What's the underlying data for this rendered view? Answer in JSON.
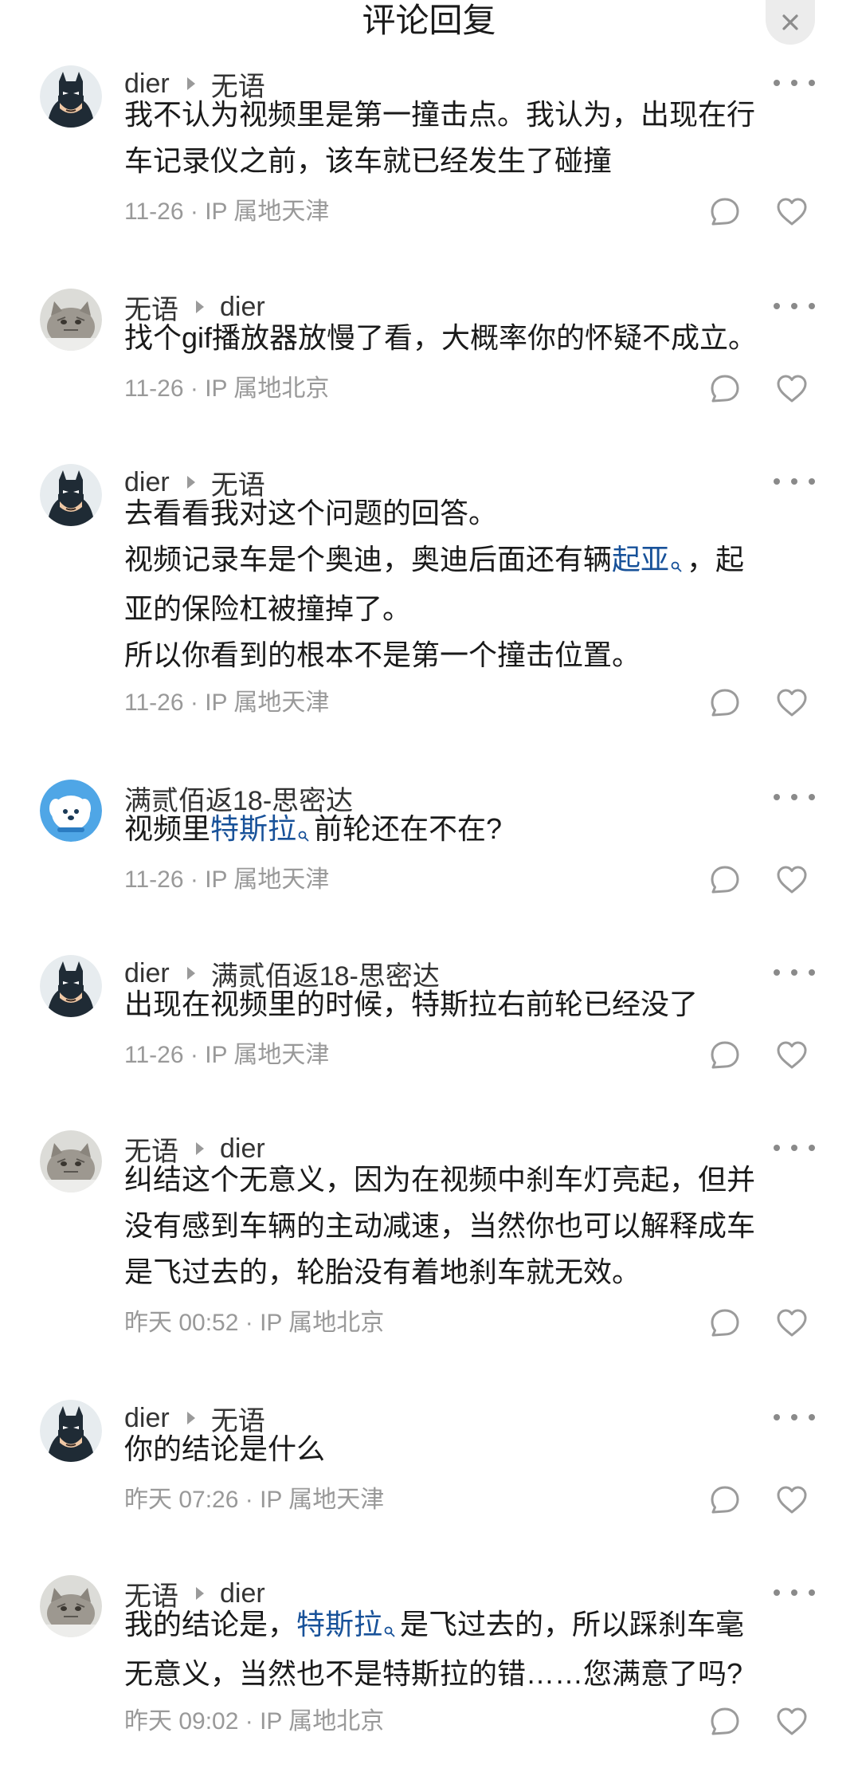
{
  "header": {
    "title": "评论回复"
  },
  "colors": {
    "link": "#175199",
    "meta": "#999999",
    "text": "#1a1a1a"
  },
  "comments": [
    {
      "avatar": "batman",
      "author": "dier",
      "reply_to": "无语",
      "lines": [
        [
          {
            "t": "我不认为视频里是第一撞击点。我认为，出现在行"
          }
        ],
        [
          {
            "t": "车记录仪之前，该车就已经发生了碰撞"
          }
        ]
      ],
      "date": "11-26",
      "ip": "IP 属地天津"
    },
    {
      "avatar": "cat",
      "author": "无语",
      "reply_to": "dier",
      "lines": [
        [
          {
            "t": "找个gif播放器放慢了看，大概率你的怀疑不成立。"
          }
        ]
      ],
      "date": "11-26",
      "ip": "IP 属地北京"
    },
    {
      "avatar": "batman",
      "author": "dier",
      "reply_to": "无语",
      "lines": [
        [
          {
            "t": "去看看我对这个问题的回答。"
          }
        ],
        [
          {
            "t": "视频记录车是个奥迪，奥迪后面还有辆"
          },
          {
            "t": "起亚",
            "link": true
          },
          {
            "t": "，起"
          }
        ],
        [
          {
            "t": "亚的保险杠被撞掉了。"
          }
        ],
        [
          {
            "t": "所以你看到的根本不是第一个撞击位置。"
          }
        ]
      ],
      "date": "11-26",
      "ip": "IP 属地天津"
    },
    {
      "avatar": "dog",
      "author": "满贰佰返18-思密达",
      "reply_to": "",
      "lines": [
        [
          {
            "t": "视频里"
          },
          {
            "t": "特斯拉",
            "link": true
          },
          {
            "t": "前轮还在不在?"
          }
        ]
      ],
      "date": "11-26",
      "ip": "IP 属地天津"
    },
    {
      "avatar": "batman",
      "author": "dier",
      "reply_to": "满贰佰返18-思密达",
      "lines": [
        [
          {
            "t": "出现在视频里的时候，特斯拉右前轮已经没了"
          }
        ]
      ],
      "date": "11-26",
      "ip": "IP 属地天津"
    },
    {
      "avatar": "cat",
      "author": "无语",
      "reply_to": "dier",
      "lines": [
        [
          {
            "t": "纠结这个无意义，因为在视频中刹车灯亮起，但并"
          }
        ],
        [
          {
            "t": "没有感到车辆的主动减速，当然你也可以解释成车"
          }
        ],
        [
          {
            "t": "是飞过去的，轮胎没有着地刹车就无效。"
          }
        ]
      ],
      "date": "昨天 00:52",
      "ip": "IP 属地北京"
    },
    {
      "avatar": "batman",
      "author": "dier",
      "reply_to": "无语",
      "lines": [
        [
          {
            "t": "你的结论是什么"
          }
        ]
      ],
      "date": "昨天 07:26",
      "ip": "IP 属地天津"
    },
    {
      "avatar": "cat",
      "author": "无语",
      "reply_to": "dier",
      "lines": [
        [
          {
            "t": "我的结论是，"
          },
          {
            "t": "特斯拉",
            "link": true
          },
          {
            "t": "是飞过去的，所以踩刹车毫"
          }
        ],
        [
          {
            "t": "无意义，当然也不是特斯拉的错……您满意了吗?"
          }
        ]
      ],
      "date": "昨天 09:02",
      "ip": "IP 属地北京"
    }
  ]
}
